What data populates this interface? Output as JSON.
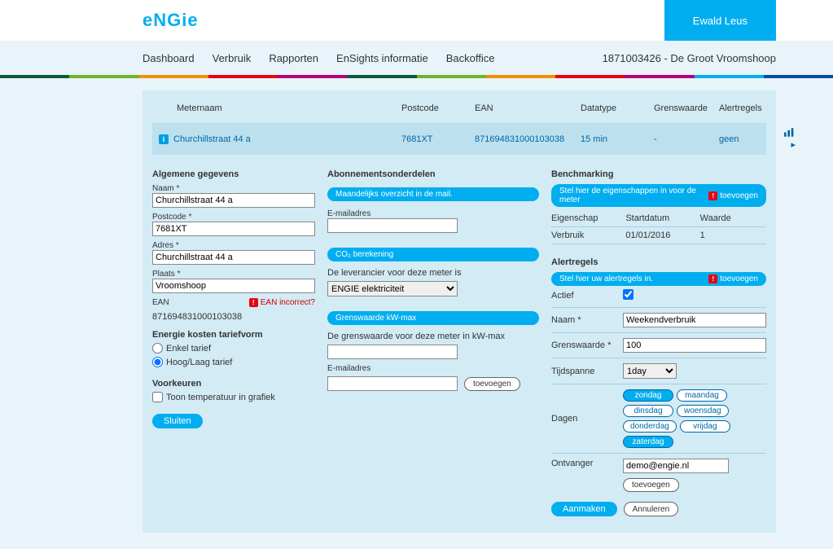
{
  "header": {
    "brand": "eNGie",
    "user": "Ewald Leus",
    "account": "1871003426 - De Groot Vroomshoop",
    "menu": [
      "Dashboard",
      "Verbruik",
      "Rapporten",
      "EnSights informatie",
      "Backoffice"
    ]
  },
  "rainbow": [
    "#0b5a3c",
    "#6fb52c",
    "#f39200",
    "#e30613",
    "#b2007a",
    "#0b5a3c",
    "#6fb52c",
    "#f39200",
    "#e30613",
    "#b2007a",
    "#00aeef",
    "#014f9c"
  ],
  "table": {
    "headers": {
      "name": "Meternaam",
      "post": "Postcode",
      "ean": "EAN",
      "dt": "Datatype",
      "gw": "Grenswaarde",
      "al": "Alertregels"
    },
    "row": {
      "name": "Churchillstraat 44 a",
      "post": "7681XT",
      "ean": "871694831000103038",
      "dt": "15 min",
      "gw": "-",
      "al": "geen"
    }
  },
  "general": {
    "title": "Algemene gegevens",
    "naam_lbl": "Naam",
    "naam": "Churchillstraat 44 a",
    "post_lbl": "Postcode",
    "post": "7681XT",
    "adres_lbl": "Adres",
    "adres": "Churchillstraat 44 a",
    "plaats_lbl": "Plaats",
    "plaats": "Vroomshoop",
    "ean_lbl": "EAN",
    "ean_inc": "EAN incorrect?",
    "ean": "871694831000103038",
    "tarief_title": "Energie kosten tariefvorm",
    "enkel": "Enkel tarief",
    "hoog": "Hoog/Laag tarief",
    "voorkeuren": "Voorkeuren",
    "toon_temp": "Toon temperatuur in grafiek",
    "sluiten": "Sluiten"
  },
  "abon": {
    "title": "Abonnementsonderdelen",
    "pill": "Maandelijks overzicht in de mail.",
    "email_lbl": "E-mailadres",
    "co2_pill": "CO₂  berekening",
    "lever": "De leverancier voor deze meter is",
    "lever_val": "ENGIE elektriciteit",
    "gw_pill": "Grenswaarde kW-max",
    "gw_txt": "De grenswaarde voor deze meter in kW-max",
    "email2_lbl": "E-mailadres",
    "toevoegen": "toevoegen"
  },
  "bench": {
    "title": "Benchmarking",
    "pill": "Stel hier de eigenschappen in voor de meter",
    "toev": "toevoegen",
    "h1": "Eigenschap",
    "h2": "Startdatum",
    "h3": "Waarde",
    "r1": "Verbruik",
    "r2": "01/01/2016",
    "r3": "1"
  },
  "alert": {
    "title": "Alertregels",
    "pill": "Stel hier uw alertregels in.",
    "toev": "toevoegen",
    "actief": "Actief",
    "naam_lbl": "Naam *",
    "naam": "Weekendverbruik",
    "gw_lbl": "Grenswaarde *",
    "gw": "100",
    "tijd_lbl": "Tijdspanne",
    "tijd": "1day",
    "dagen_lbl": "Dagen",
    "days": [
      "zondag",
      "maandag",
      "dinsdag",
      "woensdag",
      "donderdag",
      "vrijdag",
      "zaterdag"
    ],
    "days_on": [
      "zondag",
      "zaterdag"
    ],
    "ontv_lbl": "Ontvanger",
    "ontv": "demo@engie.nl",
    "ontv_btn": "toevoegen",
    "aanmaken": "Aanmaken",
    "annuleren": "Annuleren"
  }
}
